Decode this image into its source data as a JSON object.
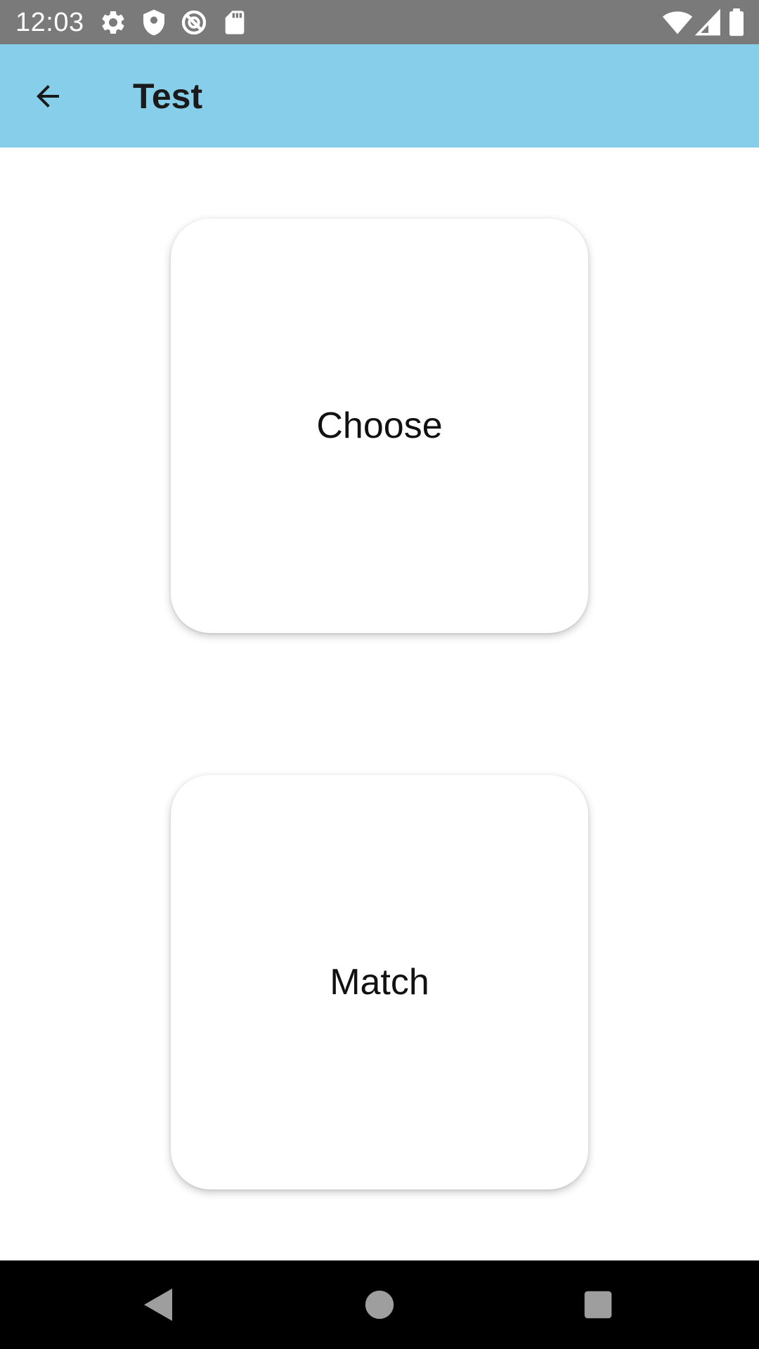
{
  "status_bar": {
    "time": "12:03",
    "icons_left": [
      "settings-icon",
      "shield-icon",
      "sync-disabled-icon",
      "sd-card-icon"
    ],
    "icons_right": [
      "wifi-icon",
      "signal-icon",
      "battery-icon"
    ]
  },
  "app_bar": {
    "title": "Test",
    "background_color": "#87ceea",
    "back_icon": "arrow-back-icon"
  },
  "cards": [
    {
      "label": "Choose"
    },
    {
      "label": "Match"
    }
  ],
  "nav_bar": {
    "buttons": [
      "back-triangle-icon",
      "home-circle-icon",
      "recents-square-icon"
    ]
  }
}
